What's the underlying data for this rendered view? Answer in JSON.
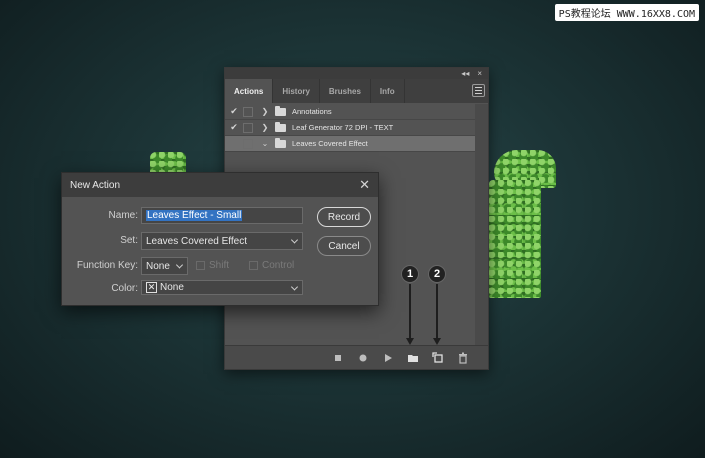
{
  "watermark": "PS教程论坛 WWW.16XX8.COM",
  "actions_panel": {
    "collapse_glyph": "◂◂",
    "close_glyph": "×",
    "tabs": [
      {
        "label": "Actions",
        "active": true
      },
      {
        "label": "History",
        "active": false
      },
      {
        "label": "Brushes",
        "active": false
      },
      {
        "label": "Info",
        "active": false
      }
    ],
    "rows": [
      {
        "check": "✔",
        "chevron": "❯",
        "label": "Annotations",
        "selected": false
      },
      {
        "check": "✔",
        "chevron": "❯",
        "label": "Leaf Generator 72 DPI - TEXT",
        "selected": false
      },
      {
        "check": "",
        "chevron": "⌄",
        "label": "Leaves Covered Effect",
        "selected": true
      }
    ],
    "bottom_icons": [
      "stop-icon",
      "record-icon",
      "play-icon",
      "new-set-folder-icon",
      "new-action-icon",
      "delete-trash-icon"
    ]
  },
  "callouts": [
    "1",
    "2"
  ],
  "dialog": {
    "title": "New Action",
    "close_glyph": "✕",
    "name_label": "Name:",
    "name_value": "Leaves Effect - Small",
    "set_label": "Set:",
    "set_value": "Leaves Covered Effect",
    "function_key_label": "Function Key:",
    "function_key_value": "None",
    "shift_label": "Shift",
    "control_label": "Control",
    "color_label": "Color:",
    "color_value": "None",
    "record_label": "Record",
    "cancel_label": "Cancel"
  },
  "colors": {
    "panel_bg": "#535353",
    "selection_blue": "#3373c2",
    "background_teal": "#1c3436"
  }
}
